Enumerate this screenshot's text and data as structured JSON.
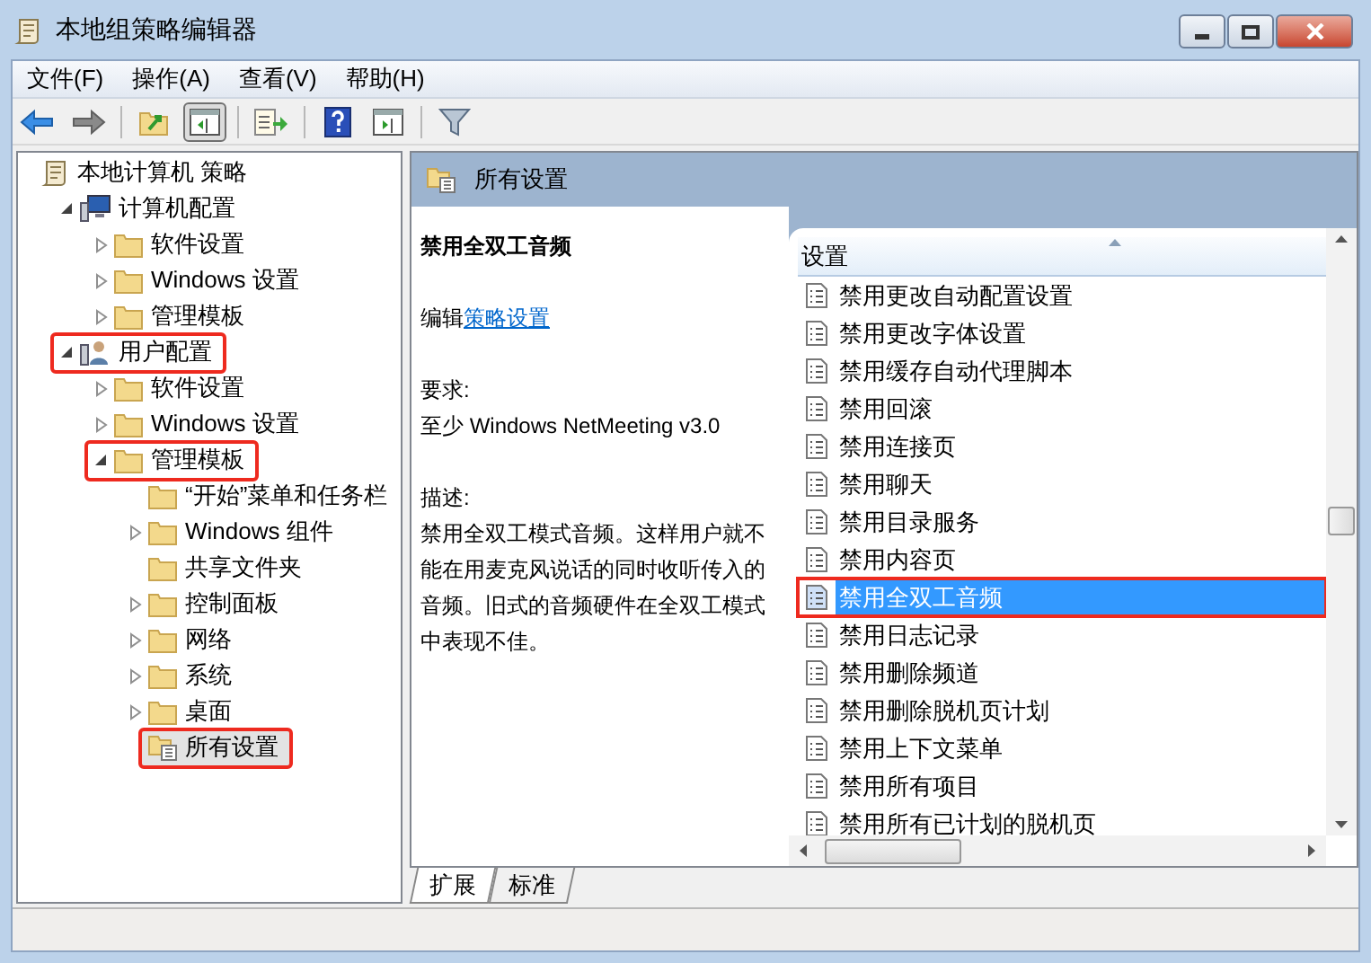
{
  "window": {
    "title": "本地组策略编辑器"
  },
  "menu": [
    "文件(F)",
    "操作(A)",
    "查看(V)",
    "帮助(H)"
  ],
  "toolbar": [
    [
      {
        "kind": "back",
        "pressed": false
      },
      {
        "kind": "forward",
        "pressed": false
      }
    ],
    [
      {
        "kind": "up",
        "pressed": false
      },
      {
        "kind": "tree",
        "pressed": true
      }
    ],
    [
      {
        "kind": "export",
        "pressed": false
      }
    ],
    [
      {
        "kind": "help",
        "pressed": false
      },
      {
        "kind": "pane",
        "pressed": false
      }
    ],
    [
      {
        "kind": "filter",
        "pressed": false
      }
    ]
  ],
  "tree": [
    {
      "label": "本地计算机 策略",
      "kind": "root",
      "has_arrow": false,
      "selected": false,
      "highlighted": false,
      "children": [
        {
          "label": "计算机配置",
          "kind": "computer",
          "has_arrow": true,
          "expanded": true,
          "selected": false,
          "highlighted": false,
          "children": [
            {
              "label": "软件设置",
              "kind": "folder",
              "has_arrow": true,
              "expanded": false,
              "selected": false,
              "highlighted": false
            },
            {
              "label": "Windows 设置",
              "kind": "folder",
              "has_arrow": true,
              "expanded": false,
              "selected": false,
              "highlighted": false
            },
            {
              "label": "管理模板",
              "kind": "folder",
              "has_arrow": true,
              "expanded": false,
              "selected": false,
              "highlighted": false
            }
          ]
        },
        {
          "label": "用户配置",
          "kind": "user",
          "has_arrow": true,
          "expanded": true,
          "selected": false,
          "highlighted": true,
          "children": [
            {
              "label": "软件设置",
              "kind": "folder",
              "has_arrow": true,
              "expanded": false,
              "selected": false,
              "highlighted": false
            },
            {
              "label": "Windows 设置",
              "kind": "folder",
              "has_arrow": true,
              "expanded": false,
              "selected": false,
              "highlighted": false
            },
            {
              "label": "管理模板",
              "kind": "folder",
              "has_arrow": true,
              "expanded": true,
              "selected": false,
              "highlighted": true,
              "children": [
                {
                  "label": "“开始”菜单和任务栏",
                  "kind": "folder",
                  "has_arrow": false,
                  "selected": false,
                  "highlighted": false
                },
                {
                  "label": "Windows 组件",
                  "kind": "folder",
                  "has_arrow": true,
                  "expanded": false,
                  "selected": false,
                  "highlighted": false
                },
                {
                  "label": "共享文件夹",
                  "kind": "folder",
                  "has_arrow": false,
                  "selected": false,
                  "highlighted": false
                },
                {
                  "label": "控制面板",
                  "kind": "folder",
                  "has_arrow": true,
                  "expanded": false,
                  "selected": false,
                  "highlighted": false
                },
                {
                  "label": "网络",
                  "kind": "folder",
                  "has_arrow": true,
                  "expanded": false,
                  "selected": false,
                  "highlighted": false
                },
                {
                  "label": "系统",
                  "kind": "folder",
                  "has_arrow": true,
                  "expanded": false,
                  "selected": false,
                  "highlighted": false
                },
                {
                  "label": "桌面",
                  "kind": "folder",
                  "has_arrow": true,
                  "expanded": false,
                  "selected": false,
                  "highlighted": false
                },
                {
                  "label": "所有设置",
                  "kind": "settings",
                  "has_arrow": false,
                  "selected": true,
                  "highlighted": true
                }
              ]
            }
          ]
        }
      ]
    }
  ],
  "panel": {
    "title": "所有设置"
  },
  "details": {
    "title": "禁用全双工音频",
    "edit_prefix": "编辑",
    "edit_link": "策略设置",
    "requirements_label": "要求:",
    "requirements": "至少 Windows NetMeeting v3.0",
    "description_label": "描述:",
    "description": "禁用全双工模式音频。这样用户就不能在用麦克风说话的同时收听传入的音频。旧式的音频硬件在全双工模式中表现不佳。"
  },
  "list": {
    "column": "设置",
    "items": [
      {
        "label": "禁用更改自动配置设置",
        "selected": false,
        "highlighted": false
      },
      {
        "label": "禁用更改字体设置",
        "selected": false,
        "highlighted": false
      },
      {
        "label": "禁用缓存自动代理脚本",
        "selected": false,
        "highlighted": false
      },
      {
        "label": "禁用回滚",
        "selected": false,
        "highlighted": false
      },
      {
        "label": "禁用连接页",
        "selected": false,
        "highlighted": false
      },
      {
        "label": "禁用聊天",
        "selected": false,
        "highlighted": false
      },
      {
        "label": "禁用目录服务",
        "selected": false,
        "highlighted": false
      },
      {
        "label": "禁用内容页",
        "selected": false,
        "highlighted": false
      },
      {
        "label": "禁用全双工音频",
        "selected": true,
        "highlighted": true
      },
      {
        "label": "禁用日志记录",
        "selected": false,
        "highlighted": false
      },
      {
        "label": "禁用删除频道",
        "selected": false,
        "highlighted": false
      },
      {
        "label": "禁用删除脱机页计划",
        "selected": false,
        "highlighted": false
      },
      {
        "label": "禁用上下文菜单",
        "selected": false,
        "highlighted": false
      },
      {
        "label": "禁用所有项目",
        "selected": false,
        "highlighted": false
      },
      {
        "label": "禁用所有已计划的脱机页",
        "selected": false,
        "highlighted": false
      }
    ]
  },
  "tabs": [
    {
      "label": "扩展",
      "selected": true
    },
    {
      "label": "标准",
      "selected": false
    }
  ]
}
